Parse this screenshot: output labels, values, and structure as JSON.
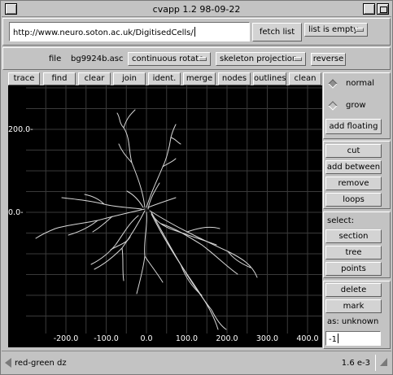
{
  "window": {
    "title": "cvapp 1.2  98-09-22"
  },
  "toolbar": {
    "url_value": "http://www.neuro.soton.ac.uk/DigitisedCells/",
    "fetch_label": "fetch list",
    "list_menu": "list is empty"
  },
  "file_row": {
    "file_label": "file",
    "file_name": "bg9924b.asc",
    "rotate_menu": "continuous rotate",
    "projection_menu": "skeleton projection",
    "reverse_label": "reverse"
  },
  "tools": {
    "trace": "trace",
    "find": "find",
    "clear": "clear",
    "join": "join",
    "ident": "ident.",
    "merge": "merge",
    "nodes": "nodes",
    "outlines": "outlines",
    "clean": "clean"
  },
  "side": {
    "mode_normal": "normal",
    "mode_grow": "grow",
    "selected_mode": "normal",
    "add_floating": "add floating",
    "cut": "cut",
    "add_between": "add between",
    "remove": "remove",
    "loops": "loops",
    "select_label": "select:",
    "section": "section",
    "tree": "tree",
    "points": "points",
    "delete": "delete",
    "mark": "mark",
    "as_label": "as: unknown",
    "number_value": "-1"
  },
  "status": {
    "left": "red-green dz",
    "right": "1.6 e-3"
  },
  "chart_data": {
    "type": "line",
    "y_tick_labels": [
      "200.0-",
      "0.0-"
    ],
    "x_tick_labels": [
      "-200.0",
      "-100.0",
      "0.0",
      "100.0",
      "200.0",
      "300.0",
      "400.0"
    ],
    "y_ticks": [
      200,
      0
    ],
    "x_ticks": [
      -200,
      -100,
      0,
      100,
      200,
      300,
      400
    ],
    "grid": true,
    "colors": {
      "background": "#000000",
      "grid": "#3a3a3a",
      "trace": "#d8d8d8",
      "labels": "#ffffff"
    }
  }
}
